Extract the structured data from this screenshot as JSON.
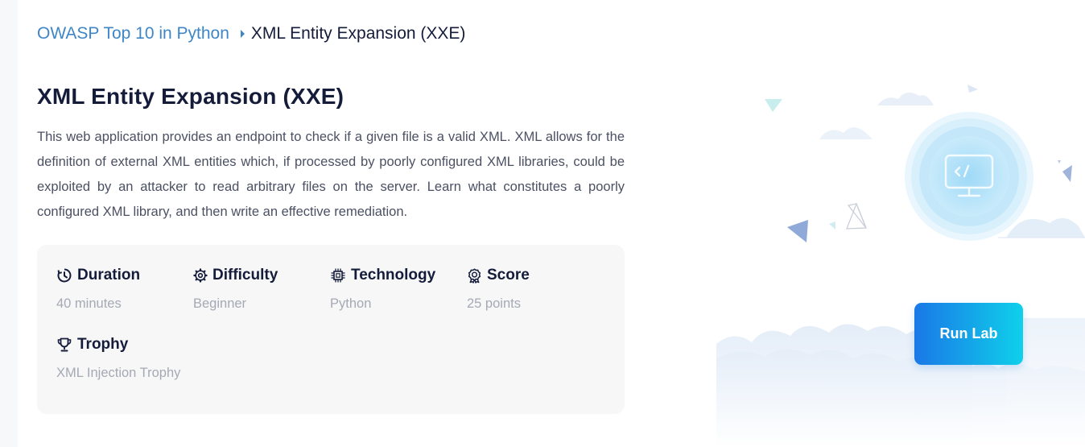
{
  "breadcrumb": {
    "parent": "OWASP Top 10 in Python",
    "current": "XML Entity Expansion (XXE)"
  },
  "lab": {
    "title": "XML Entity Expansion (XXE)",
    "description": "This web application provides an endpoint to check if a given file is a valid XML. XML allows for the definition of external XML entities which, if processed by poorly configured XML libraries, could be exploited by an attacker to read arbitrary files on the server. Learn what constitutes a poorly configured XML library, and then write an effective remediation."
  },
  "details": {
    "duration": {
      "label": "Duration",
      "value": "40 minutes",
      "icon": "clock-icon"
    },
    "difficulty": {
      "label": "Difficulty",
      "value": "Beginner",
      "icon": "gear-icon"
    },
    "technology": {
      "label": "Technology",
      "value": "Python",
      "icon": "chip-icon"
    },
    "score": {
      "label": "Score",
      "value": "25 points",
      "icon": "award-icon"
    },
    "trophy": {
      "label": "Trophy",
      "value": "XML Injection Trophy",
      "icon": "trophy-icon"
    }
  },
  "actions": {
    "run_lab": "Run Lab"
  },
  "colors": {
    "link": "#3f86c6",
    "heading": "#141c3a",
    "button_gradient_start": "#1a78e6",
    "button_gradient_end": "#0fd0ea",
    "detail_value": "#a5a9b4"
  }
}
